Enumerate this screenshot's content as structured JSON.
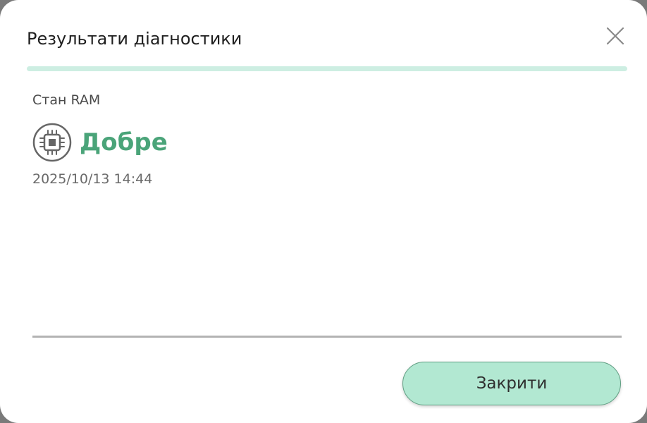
{
  "dialog": {
    "title": "Результати діагностики",
    "close_icon": "close-icon"
  },
  "result": {
    "label": "Стан RAM",
    "icon": "memory-chip-icon",
    "status": "Добре",
    "timestamp": "2025/10/13 14:44"
  },
  "footer": {
    "close_label": "Закрити"
  },
  "colors": {
    "accent_rule": "#cdeee2",
    "status_good": "#4aa479",
    "button_bg": "#b2e8d2",
    "button_border": "#5f9e82"
  }
}
